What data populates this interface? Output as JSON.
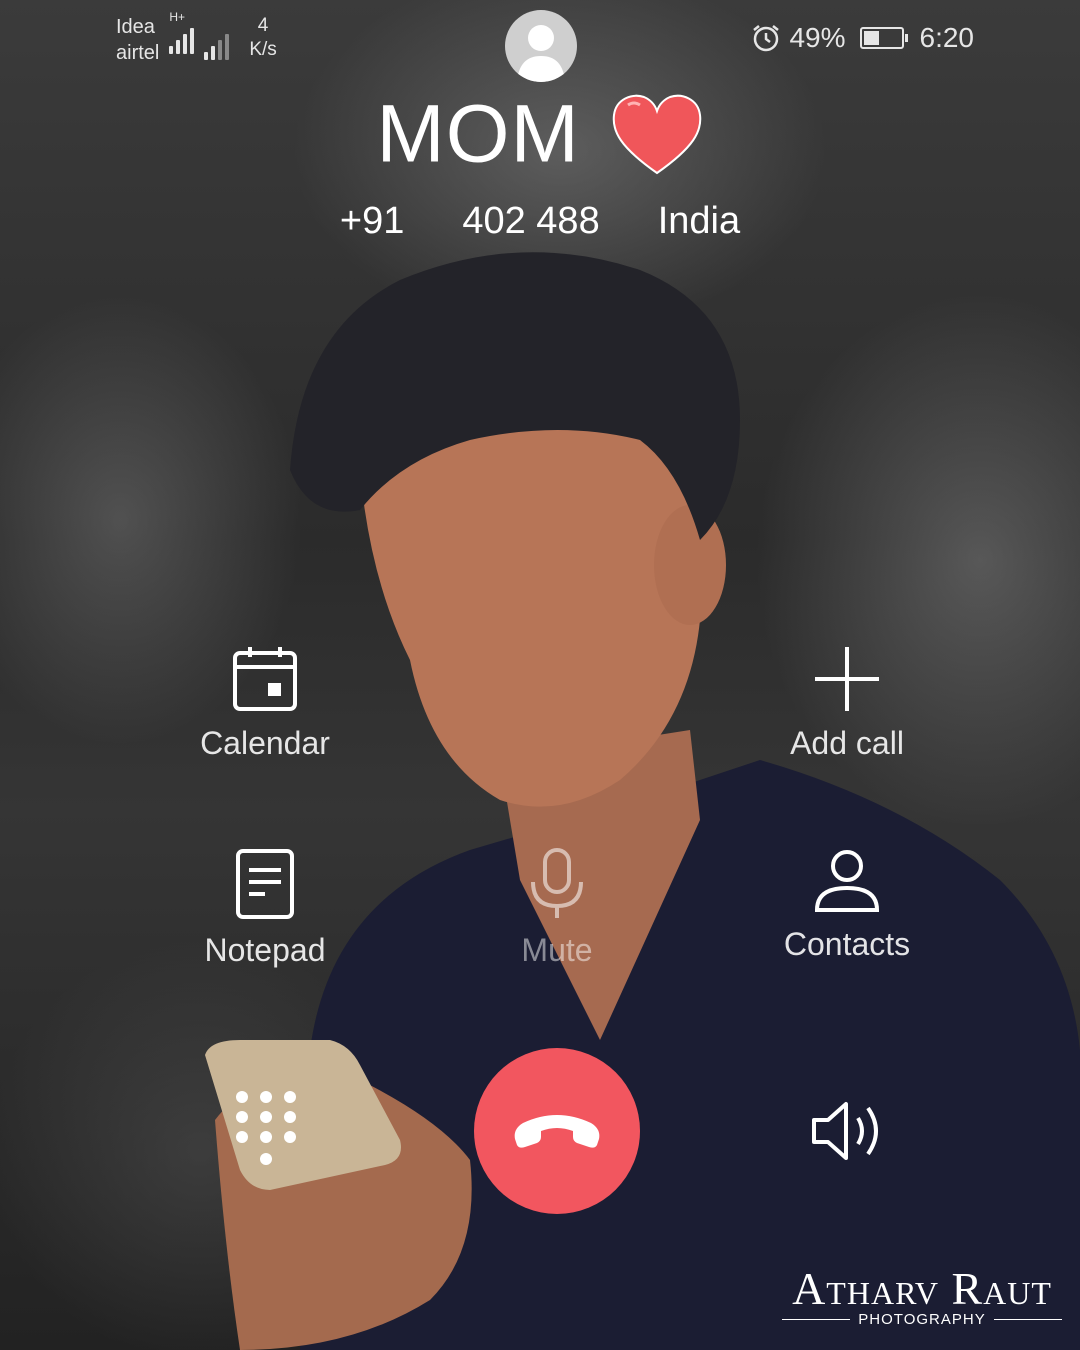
{
  "status_bar": {
    "carrier_1": "Idea",
    "carrier_2": "airtel",
    "network_type": "H+",
    "speed_value": "4",
    "speed_unit": "K/s",
    "alarm_icon": "alarm-clock-icon",
    "battery_percent_text": "49%",
    "battery_level": 0.49,
    "time": "6:20"
  },
  "caller": {
    "avatar_icon": "person-avatar-icon",
    "name": "MOM",
    "emoji": "heart-icon",
    "country_code": "+91",
    "number": "402 488",
    "location": "India"
  },
  "controls": {
    "calendar": {
      "label": "Calendar",
      "icon": "calendar-icon"
    },
    "add_call": {
      "label": "Add call",
      "icon": "plus-icon"
    },
    "notepad": {
      "label": "Notepad",
      "icon": "notepad-icon"
    },
    "mute": {
      "label": "Mute",
      "icon": "microphone-icon"
    },
    "contacts": {
      "label": "Contacts",
      "icon": "person-icon"
    },
    "dialpad": {
      "icon": "dialpad-icon"
    },
    "end_call": {
      "icon": "hang-up-icon",
      "color": "#f2565f"
    },
    "speaker": {
      "icon": "speaker-icon"
    }
  },
  "watermark": {
    "name": "Atharv Raut",
    "subtitle": "PHOTOGRAPHY"
  }
}
